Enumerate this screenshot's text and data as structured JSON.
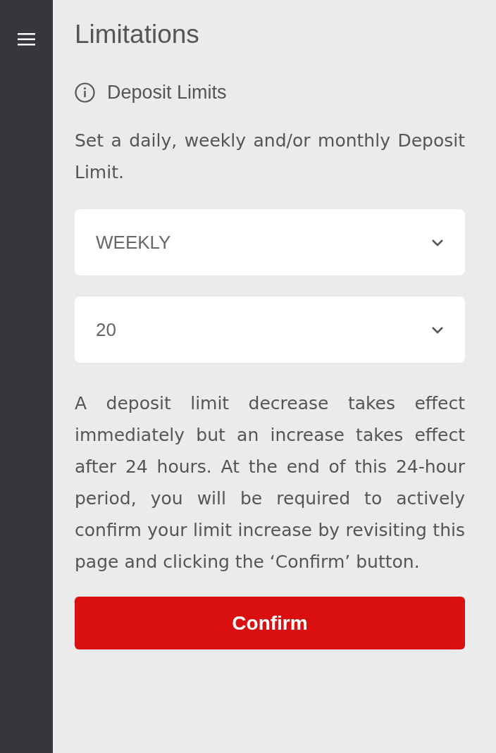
{
  "title": "Limitations",
  "section": {
    "label": "Deposit Limits"
  },
  "intro": "Set a daily, weekly and/or monthly Deposit Limit.",
  "dropdowns": [
    {
      "value": "WEEKLY"
    },
    {
      "value": "20"
    }
  ],
  "notice": "A deposit limit decrease takes effect immediately but an increase takes effect after 24 hours. At the end of this 24-hour period, you will be required to actively confirm your limit increase by revisiting this page and clicking the ‘Confirm’ button.",
  "button": "Confirm"
}
